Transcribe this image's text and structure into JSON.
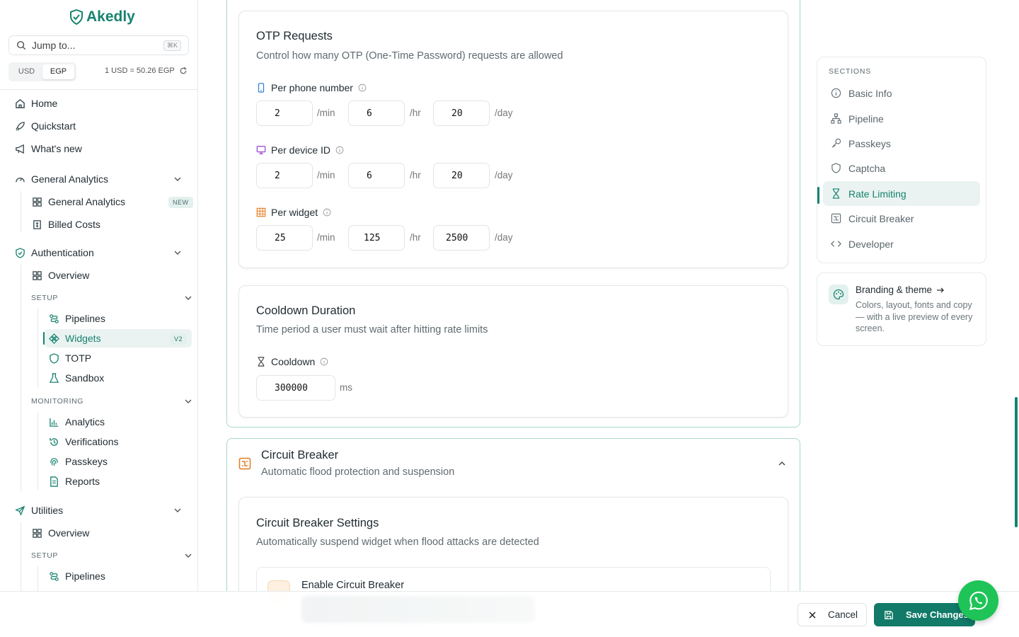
{
  "app": {
    "brand": "Akedly"
  },
  "sidebar": {
    "search_placeholder": "Jump to...",
    "search_shortcut": "⌘K",
    "currency": {
      "options": [
        "USD",
        "EGP"
      ],
      "selected": "EGP",
      "rate": "1 USD = 50.26 EGP"
    },
    "top_items": [
      {
        "label": "Home",
        "icon": "home-icon"
      },
      {
        "label": "Quickstart",
        "icon": "rocket-icon"
      },
      {
        "label": "What's new",
        "icon": "megaphone-icon"
      }
    ],
    "general_analytics": {
      "label": "General Analytics",
      "items": [
        {
          "label": "General Analytics",
          "badge": "NEW"
        },
        {
          "label": "Billed Costs"
        }
      ]
    },
    "authentication": {
      "label": "Authentication",
      "overview": "Overview",
      "setup_label": "SETUP",
      "setup_items": [
        {
          "label": "Pipelines"
        },
        {
          "label": "Widgets",
          "badge": "V2"
        },
        {
          "label": "TOTP"
        },
        {
          "label": "Sandbox"
        }
      ],
      "monitoring_label": "MONITORING",
      "monitoring_items": [
        {
          "label": "Analytics"
        },
        {
          "label": "Verifications"
        },
        {
          "label": "Passkeys"
        },
        {
          "label": "Reports"
        }
      ]
    },
    "utilities": {
      "label": "Utilities",
      "overview": "Overview",
      "setup_label": "SETUP",
      "setup_items": [
        {
          "label": "Pipelines"
        }
      ]
    }
  },
  "otp": {
    "title": "OTP Requests",
    "subtitle": "Control how many OTP (One-Time Password) requests are allowed",
    "rows": [
      {
        "label": "Per phone number",
        "min": "2",
        "hr": "6",
        "day": "20"
      },
      {
        "label": "Per device ID",
        "min": "2",
        "hr": "6",
        "day": "20"
      },
      {
        "label": "Per widget",
        "min": "25",
        "hr": "125",
        "day": "2500"
      }
    ],
    "units": {
      "min": "/min",
      "hr": "/hr",
      "day": "/day"
    }
  },
  "cooldown": {
    "title": "Cooldown Duration",
    "subtitle": "Time period a user must wait after hitting rate limits",
    "label": "Cooldown",
    "value": "300000",
    "unit": "ms"
  },
  "circuit_breaker": {
    "title": "Circuit Breaker",
    "subtitle": "Automatic flood protection and suspension",
    "settings_title": "Circuit Breaker Settings",
    "settings_subtitle": "Automatically suspend widget when flood attacks are detected",
    "enable_label": "Enable Circuit Breaker"
  },
  "sections_nav": {
    "heading": "SECTIONS",
    "items": [
      {
        "label": "Basic Info",
        "icon": "info-icon"
      },
      {
        "label": "Pipeline",
        "icon": "pipeline-icon"
      },
      {
        "label": "Passkeys",
        "icon": "key-icon"
      },
      {
        "label": "Captcha",
        "icon": "shield-icon"
      },
      {
        "label": "Rate Limiting",
        "icon": "hourglass-icon",
        "active": true
      },
      {
        "label": "Circuit Breaker",
        "icon": "circuit-icon"
      },
      {
        "label": "Developer",
        "icon": "code-icon"
      }
    ]
  },
  "branding": {
    "title": "Branding & theme",
    "description": "Colors, layout, fonts and copy — with a live preview of every screen."
  },
  "footer": {
    "cancel": "Cancel",
    "save": "Save Changes"
  },
  "colors": {
    "accent": "#17826f",
    "save_button": "#117a68",
    "whatsapp": "#1ec457",
    "circuit_icon": "#e47b1c"
  }
}
